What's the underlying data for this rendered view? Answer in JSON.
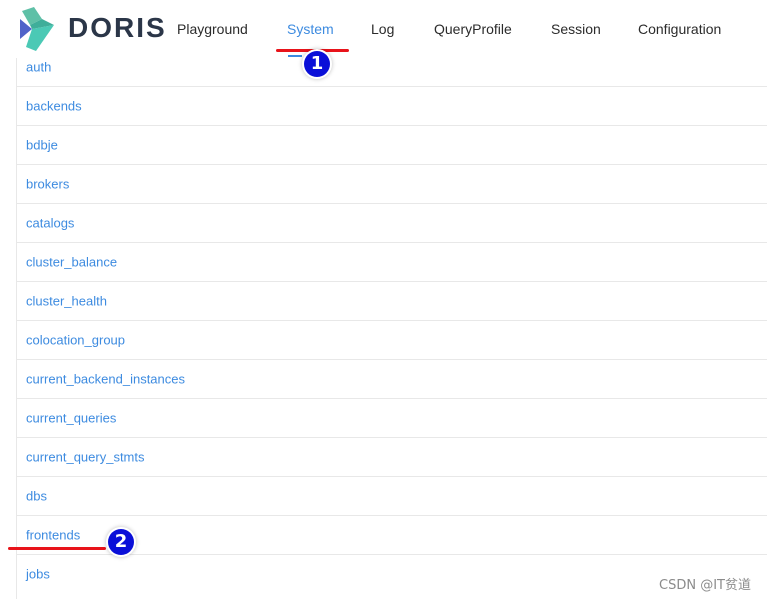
{
  "header": {
    "brand": "DORIS",
    "nav": [
      "Playground",
      "System",
      "Log",
      "QueryProfile",
      "Session",
      "Configuration"
    ],
    "active_index": 1
  },
  "annotations": {
    "badge_1": "1",
    "badge_2": "2"
  },
  "list": {
    "items": [
      "auth",
      "backends",
      "bdbje",
      "brokers",
      "catalogs",
      "cluster_balance",
      "cluster_health",
      "colocation_group",
      "current_backend_instances",
      "current_queries",
      "current_query_stmts",
      "dbs",
      "frontends",
      "jobs"
    ]
  },
  "watermark": "CSDN @IT贫道",
  "colors": {
    "accent": "#3d8be0",
    "annotation_red": "#e8131a",
    "badge_blue": "#0a0fd8"
  }
}
